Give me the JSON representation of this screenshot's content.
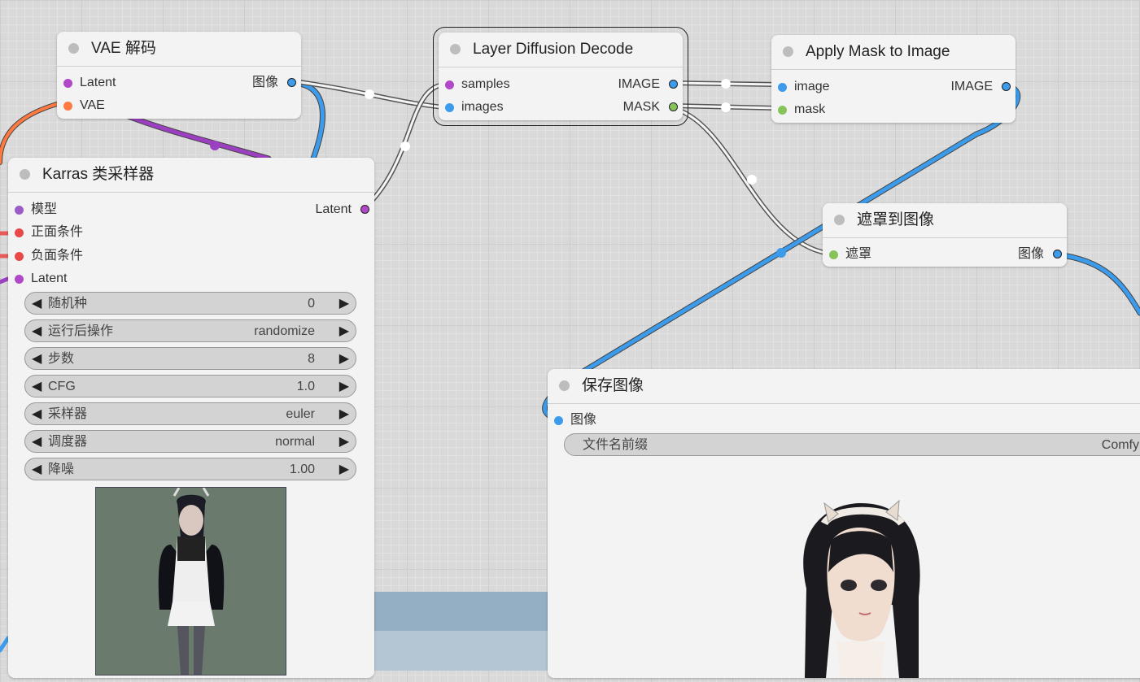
{
  "colors": {
    "latent": "#b048c8",
    "image": "#3c9bea",
    "mask": "#86c45a",
    "vae": "#ff7a40",
    "cond": "#e84848",
    "model": "#9c5cc8",
    "wire_image": "#3c9bea",
    "wire_mask": "#5a5a5a",
    "wire_latent": "#9b40c0",
    "wire_vae": "#ff7a40"
  },
  "nodes": {
    "vae_decode": {
      "title": "VAE 解码",
      "inputs": [
        {
          "label": "Latent",
          "type": "latent"
        },
        {
          "label": "VAE",
          "type": "vae"
        }
      ],
      "outputs": [
        {
          "label": "图像",
          "type": "image"
        }
      ]
    },
    "layer_diffusion": {
      "title": "Layer Diffusion Decode",
      "inputs": [
        {
          "label": "samples",
          "type": "latent"
        },
        {
          "label": "images",
          "type": "image"
        }
      ],
      "outputs": [
        {
          "label": "IMAGE",
          "type": "image"
        },
        {
          "label": "MASK",
          "type": "mask"
        }
      ]
    },
    "apply_mask": {
      "title": "Apply Mask to Image",
      "inputs": [
        {
          "label": "image",
          "type": "image"
        },
        {
          "label": "mask",
          "type": "mask"
        }
      ],
      "outputs": [
        {
          "label": "IMAGE",
          "type": "image"
        }
      ]
    },
    "mask_to_image": {
      "title": "遮罩到图像",
      "inputs": [
        {
          "label": "遮罩",
          "type": "mask"
        }
      ],
      "outputs": [
        {
          "label": "图像",
          "type": "image"
        }
      ]
    },
    "karras_sampler": {
      "title": "Karras 类采样器",
      "inputs": [
        {
          "label": "模型",
          "type": "model"
        },
        {
          "label": "正面条件",
          "type": "cond"
        },
        {
          "label": "负面条件",
          "type": "cond"
        },
        {
          "label": "Latent",
          "type": "latent"
        }
      ],
      "outputs": [
        {
          "label": "Latent",
          "type": "latent"
        }
      ],
      "widgets": [
        {
          "label": "随机种",
          "value": "0"
        },
        {
          "label": "运行后操作",
          "value": "randomize"
        },
        {
          "label": "步数",
          "value": "8"
        },
        {
          "label": "CFG",
          "value": "1.0"
        },
        {
          "label": "采样器",
          "value": "euler"
        },
        {
          "label": "调度器",
          "value": "normal"
        },
        {
          "label": "降噪",
          "value": "1.00"
        }
      ]
    },
    "save_image": {
      "title": "保存图像",
      "inputs": [
        {
          "label": "图像",
          "type": "image"
        }
      ],
      "widgets": [
        {
          "label": "文件名前缀",
          "value": "Comfy"
        }
      ]
    }
  },
  "arrows": {
    "left": "◀",
    "right": "▶"
  }
}
